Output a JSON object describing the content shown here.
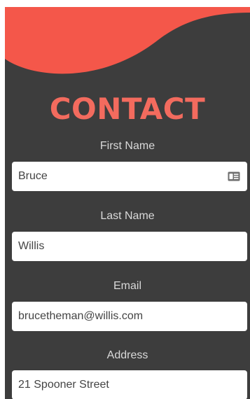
{
  "colors": {
    "accent": "#f4574a",
    "title": "#f36b5e",
    "panel": "#3d3d3d",
    "label": "#d9d9d9"
  },
  "form": {
    "title": "CONTACT",
    "fields": [
      {
        "label": "First Name",
        "value": "Bruce",
        "icon": "contact-card-icon"
      },
      {
        "label": "Last Name",
        "value": "Willis"
      },
      {
        "label": "Email",
        "value": "brucetheman@willis.com"
      },
      {
        "label": "Address",
        "value": "21 Spooner Street"
      }
    ]
  }
}
